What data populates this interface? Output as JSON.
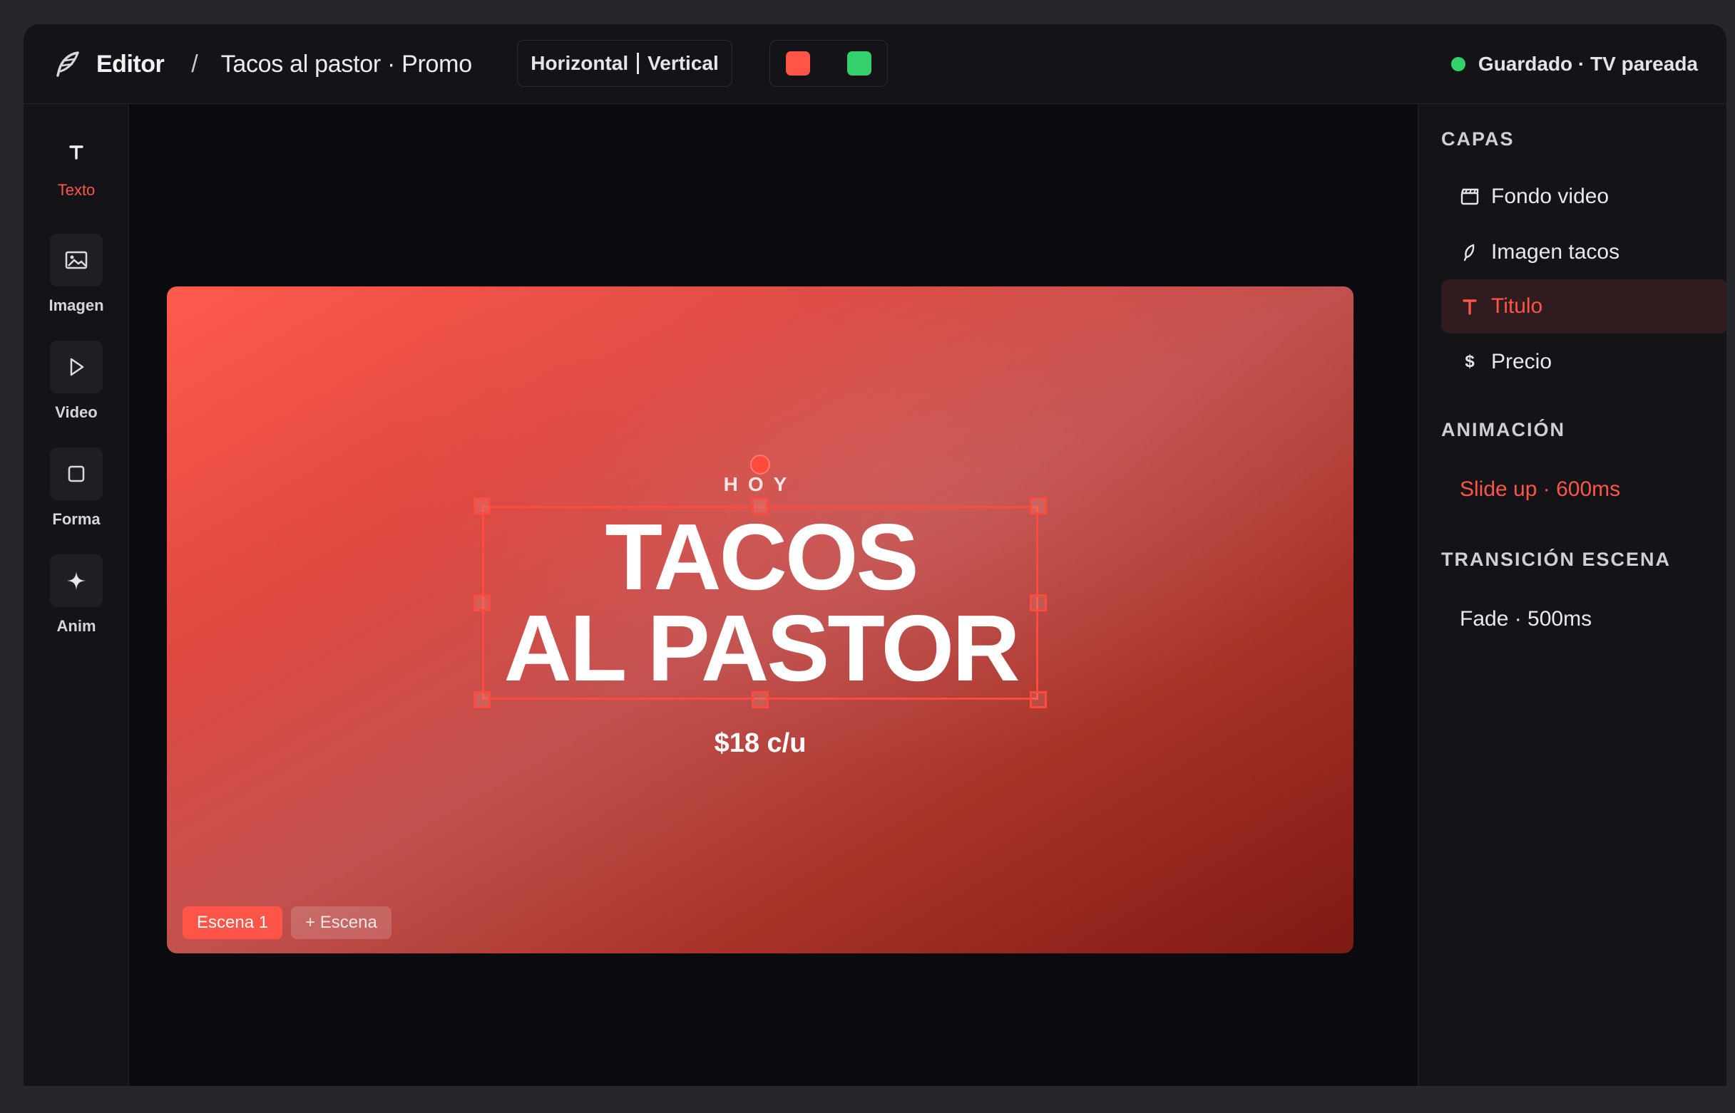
{
  "app": {
    "brand_name": "Editor",
    "breadcrumb_separator": "/",
    "project_name": "Tacos al pastor · Promo",
    "brand_icon": "feather-icon"
  },
  "orientation": {
    "horizontal_label": "Horizontal",
    "vertical_label": "Vertical"
  },
  "swatches": [
    {
      "color": "#ff5548"
    },
    {
      "color": "#34d06e"
    }
  ],
  "status": {
    "text": "Guardado · TV pareada",
    "dot_color": "#34d06e"
  },
  "tools": [
    {
      "label": "Texto",
      "icon": "text-icon",
      "active": true
    },
    {
      "label": "Imagen",
      "icon": "image-icon",
      "active": false
    },
    {
      "label": "Video",
      "icon": "play-icon",
      "active": false
    },
    {
      "label": "Forma",
      "icon": "square-icon",
      "active": false
    },
    {
      "label": "Anim",
      "icon": "sparkle-icon",
      "active": false
    }
  ],
  "slide": {
    "kicker": "HOY",
    "headline_line1": "TACOS",
    "headline_line2": "AL PASTOR",
    "price": "$18 c/u",
    "scenes": {
      "active_label": "Escena 1",
      "add_label": "+ Escena"
    }
  },
  "panel": {
    "layers_title": "CAPAS",
    "layers": [
      {
        "label": "Fondo video",
        "icon": "clapperboard-icon",
        "selected": false
      },
      {
        "label": "Imagen tacos",
        "icon": "leaf-icon",
        "selected": false
      },
      {
        "label": "Titulo",
        "icon": "text-icon",
        "selected": true
      },
      {
        "label": "Precio",
        "icon": "dollar-icon",
        "selected": false
      }
    ],
    "animation_title": "ANIMACIÓN",
    "animation_value": "Slide up · 600ms",
    "transition_title": "TRANSICIÓN ESCENA",
    "transition_value": "Fade · 500ms"
  },
  "colors": {
    "accent": "#ff5548",
    "success": "#34d06e",
    "background": "#0b0b0f",
    "panel": "#141418"
  }
}
